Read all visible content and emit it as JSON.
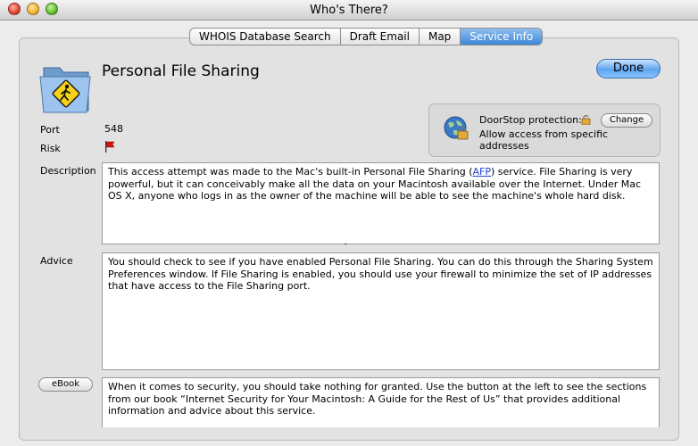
{
  "window": {
    "title": "Who's There?"
  },
  "tabs": [
    {
      "label": "WHOIS Database Search",
      "active": false
    },
    {
      "label": "Draft Email",
      "active": false
    },
    {
      "label": "Map",
      "active": false
    },
    {
      "label": "Service Info",
      "active": true
    }
  ],
  "service": {
    "title": "Personal File Sharing",
    "done_label": "Done",
    "port_label": "Port",
    "port_value": "548",
    "risk_label": "Risk",
    "risk_level_color": "#d21414"
  },
  "doorstop": {
    "label": "DoorStop protection:",
    "change_label": "Change",
    "status": "Allow access from specific addresses"
  },
  "description": {
    "label": "Description",
    "text_before": "This access attempt was made to the Mac's built-in Personal File Sharing (",
    "link_text": "AFP",
    "text_after": ") service. File Sharing is very powerful, but it can conceivably make all the data on your Macintosh available over the Internet. Under Mac OS X, anyone who logs in as the owner of the machine will be able to see the machine's whole hard disk."
  },
  "advice": {
    "label": "Advice",
    "text": "You should check to see if you have enabled Personal File Sharing. You can do this through the Sharing System Preferences window. If File Sharing is enabled, you should use your firewall to minimize the set of IP addresses that have access to the File Sharing port."
  },
  "ebook": {
    "button_label": "eBook",
    "text": "When it comes to security, you should take nothing for granted. Use the button at the left to see the sections from our book “Internet Security for Your Macintosh: A Guide for the Rest of Us” that provides additional information and advice about this service."
  },
  "icons": {
    "folder": "folder-pedestrian-icon",
    "flag": "flag-icon",
    "globe": "globe-lock-icon",
    "lock": "lock-icon",
    "splitter": "splitter-grip-icon"
  },
  "splitter_glyph": "ˆ"
}
